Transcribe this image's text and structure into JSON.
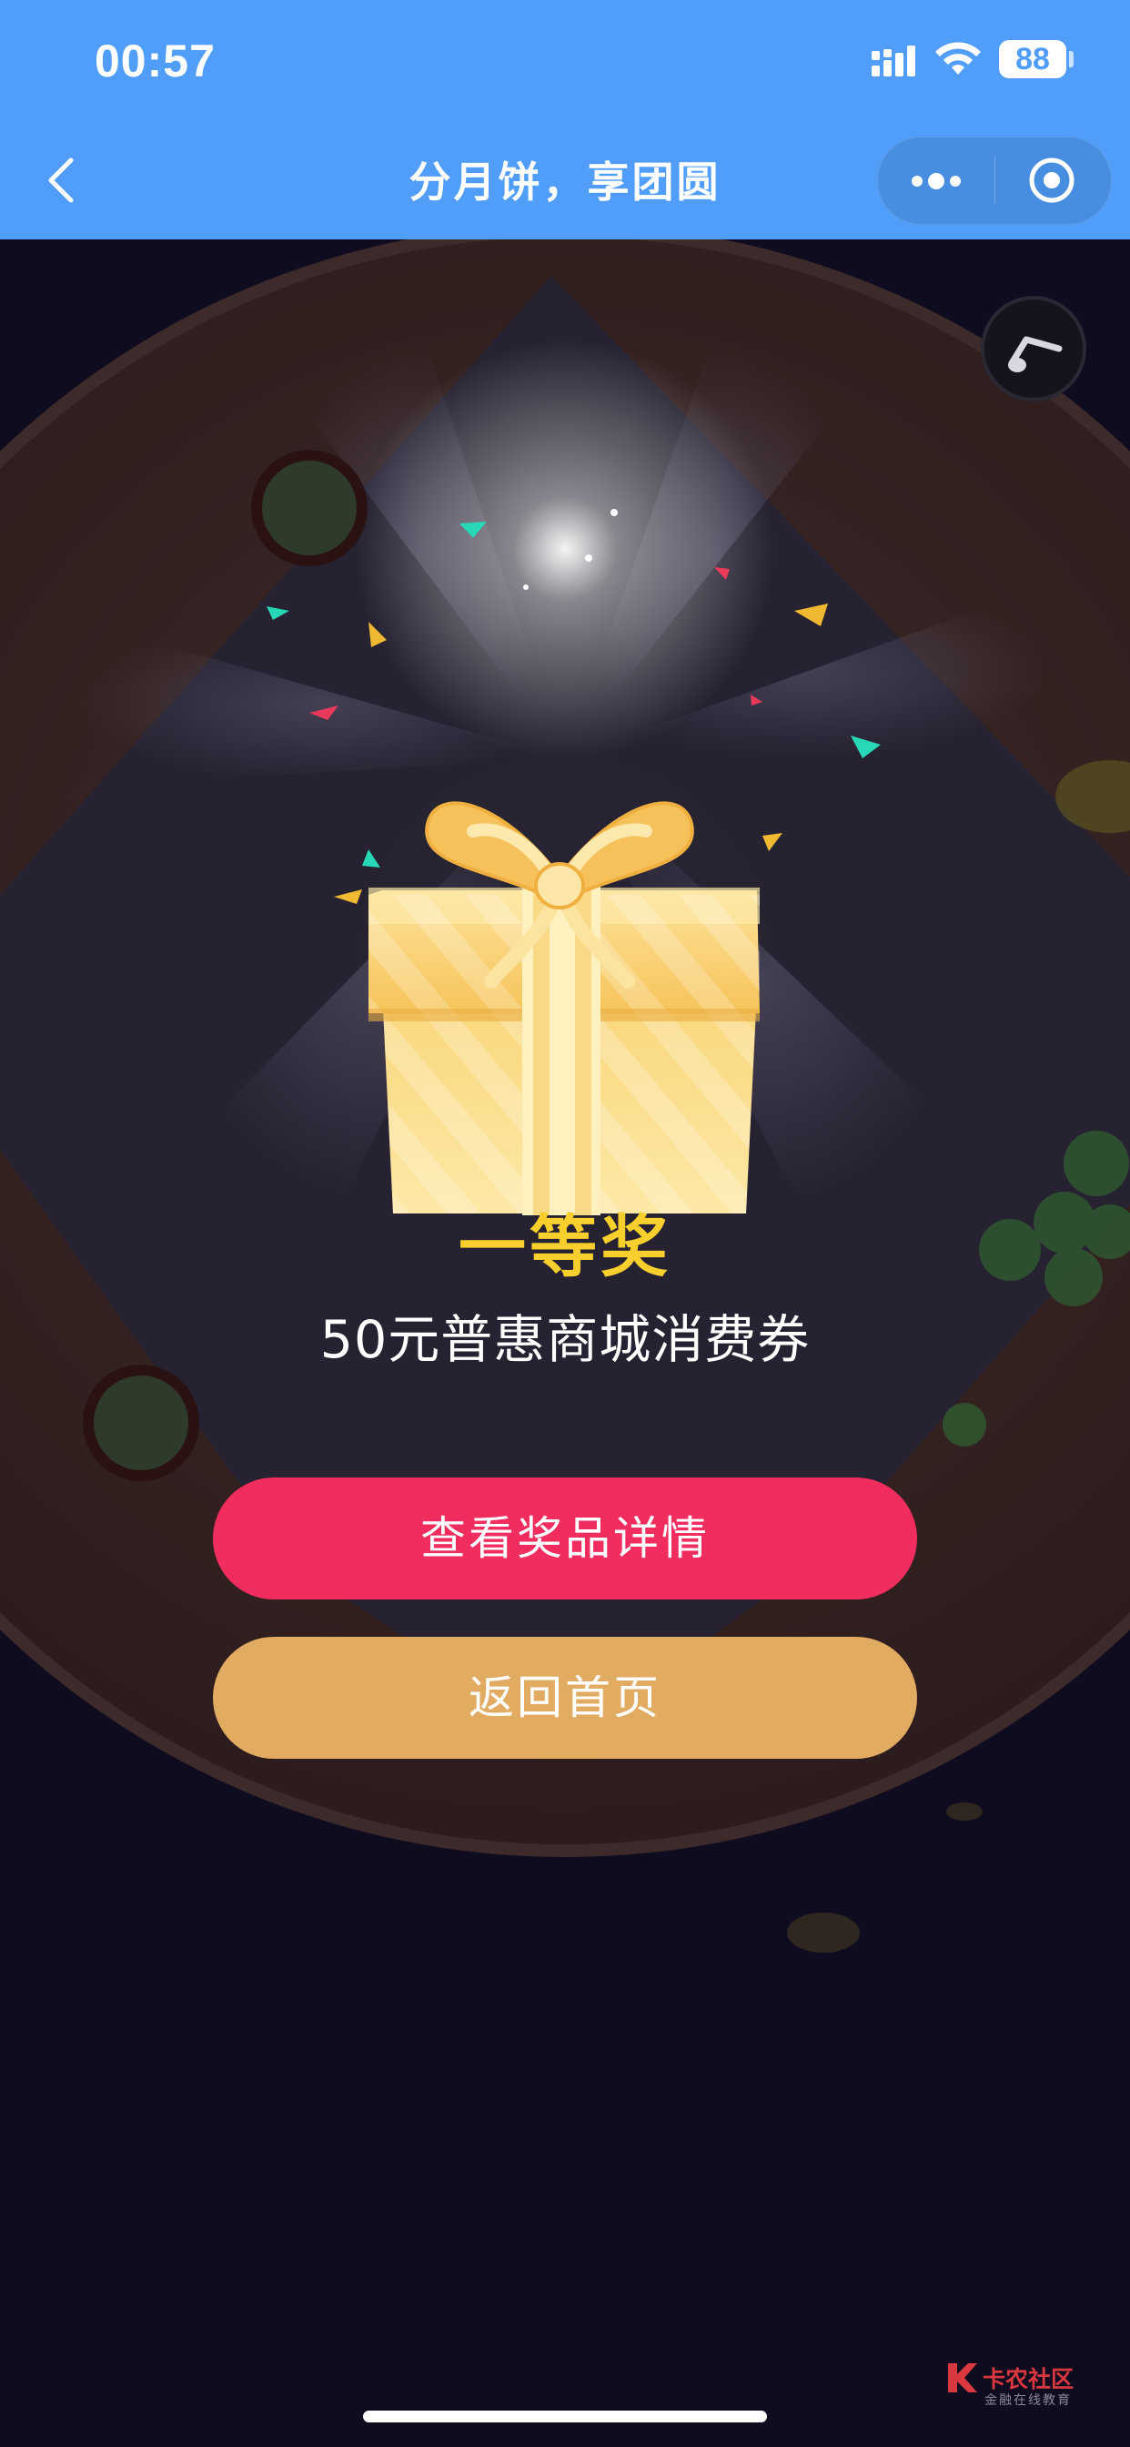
{
  "status_bar": {
    "time": "00:57",
    "battery": "88",
    "icons": [
      "cellular-signal-icon",
      "wifi-icon",
      "battery-icon"
    ]
  },
  "nav": {
    "title": "分月饼，享团圆",
    "back_icon": "chevron-left-icon",
    "more_icon": "more-dots-icon",
    "close_icon": "target-close-icon"
  },
  "music_icon": "music-note-icon",
  "prize": {
    "level": "一等奖",
    "name": "50元普惠商城消费券"
  },
  "buttons": {
    "view_detail": "查看奖品详情",
    "back_home": "返回首页"
  },
  "watermark": {
    "title": "卡农社区",
    "subtitle": "金融在线教育"
  },
  "colors": {
    "nav_blue": "#509efa",
    "background": "#0f0c20",
    "prize_gold": "#f8cf2c",
    "detail_button": "#f12d5f",
    "home_button": "#e2ab62"
  }
}
